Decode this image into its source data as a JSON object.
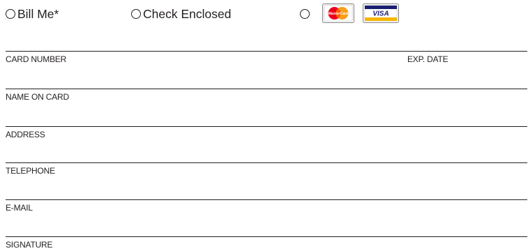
{
  "payment_options": {
    "bill_me": "Bill Me*",
    "check_enclosed": "Check Enclosed",
    "credit_card": {
      "mastercard_logo_text": "MasterCard",
      "visa_logo_text": "VISA"
    }
  },
  "fields": {
    "card_number": "CARD NUMBER",
    "exp_date": "EXP. DATE",
    "name_on_card": "NAME ON CARD",
    "address": "ADDRESS",
    "telephone": "TELEPHONE",
    "email": "E-MAIL",
    "signature": "SIGNATURE"
  },
  "colors": {
    "ink": "#231f20",
    "mastercard_red": "#eb001b",
    "mastercard_orange": "#f79e1b",
    "visa_blue": "#1a1f71",
    "visa_gold": "#f7b600"
  }
}
